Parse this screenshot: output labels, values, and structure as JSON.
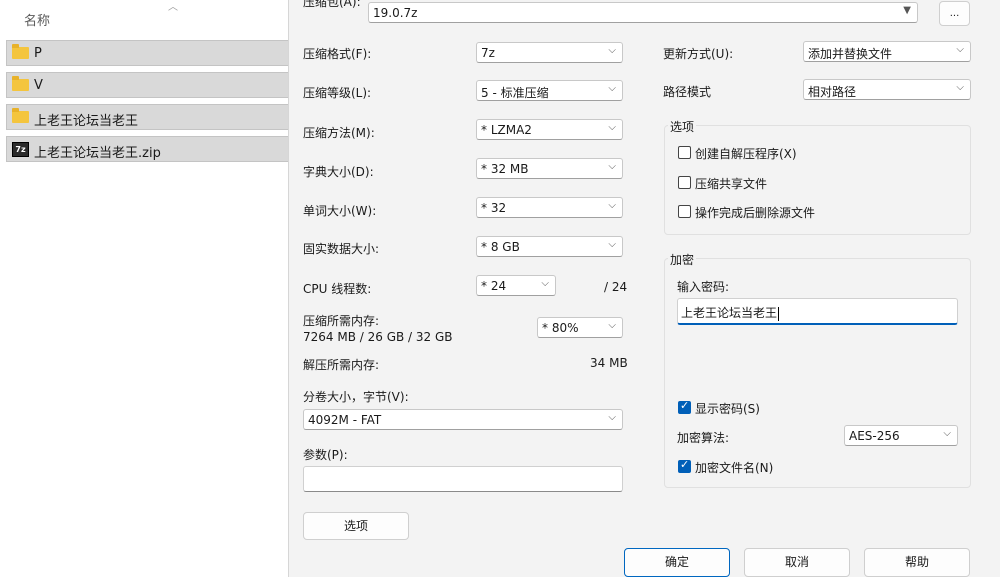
{
  "explorer": {
    "column_name": "名称",
    "sort_icon": "chevron-up",
    "files": [
      {
        "name": "P",
        "icon": "folder"
      },
      {
        "name": "V",
        "icon": "folder"
      },
      {
        "name": "上老王论坛当老王",
        "icon": "folder"
      },
      {
        "name": "上老王论坛当老王.zip",
        "icon": "7z-archive",
        "icon_text": "7z"
      }
    ]
  },
  "dialog": {
    "archive_label": "压缩包(A):",
    "archive_value": "19.0.7z",
    "browse_label": "...",
    "format_label": "压缩格式(F):",
    "format_value": "7z",
    "level_label": "压缩等级(L):",
    "level_value": "5 - 标准压缩",
    "method_label": "压缩方法(M):",
    "method_value": "* LZMA2",
    "dict_label": "字典大小(D):",
    "dict_value": "* 32 MB",
    "word_label": "单词大小(W):",
    "word_value": "* 32",
    "solid_label": "固实数据大小:",
    "solid_value": "* 8 GB",
    "cpu_label": "CPU 线程数:",
    "cpu_value": "* 24",
    "cpu_total": "/ 24",
    "mem_comp_label": "压缩所需内存:",
    "mem_comp_value": "7264 MB / 26 GB / 32 GB",
    "mem_percent": "* 80%",
    "mem_decomp_label": "解压所需内存:",
    "mem_decomp_value": "34 MB",
    "split_label": "分卷大小，字节(V):",
    "split_value": "4092M - FAT",
    "params_label": "参数(P):",
    "params_value": "",
    "options_button": "选项",
    "update_label": "更新方式(U):",
    "update_value": "添加并替换文件",
    "path_label": "路径模式",
    "path_value": "相对路径",
    "options_group": {
      "title": "选项",
      "sfx": {
        "label": "创建自解压程序(X)",
        "checked": false
      },
      "shared": {
        "label": "压缩共享文件",
        "checked": false
      },
      "delete": {
        "label": "操作完成后删除源文件",
        "checked": false
      }
    },
    "encryption": {
      "title": "加密",
      "password_label": "输入密码:",
      "password_value": "上老王论坛当老王",
      "show_password": {
        "label": "显示密码(S)",
        "checked": true
      },
      "method_label": "加密算法:",
      "method_value": "AES-256",
      "encrypt_names": {
        "label": "加密文件名(N)",
        "checked": true
      }
    },
    "ok_button": "确定",
    "cancel_button": "取消",
    "help_button": "帮助"
  },
  "colors": {
    "accent": "#005fb8",
    "selected_row": "#d9d9d9",
    "dialog_bg": "#f3f3f3",
    "folder": "#f4c53e"
  }
}
